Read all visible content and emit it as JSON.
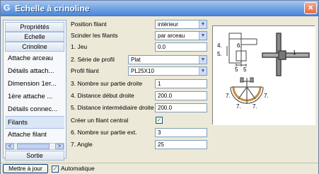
{
  "window": {
    "title": "Echelle à crinoline",
    "icon": "app-icon",
    "close_label": "×"
  },
  "sidebar": {
    "headers": [
      "Propriétés",
      "Echelle",
      "Crinoline"
    ],
    "items": [
      {
        "label": "Attache arceau",
        "selected": false
      },
      {
        "label": "Détails attach...",
        "selected": false
      },
      {
        "label": "Dimension 1er...",
        "selected": false
      },
      {
        "label": "1ère attache ...",
        "selected": false
      },
      {
        "label": "Détails connec...",
        "selected": false
      },
      {
        "label": "Filants",
        "selected": true
      },
      {
        "label": "Attache filant",
        "selected": false
      }
    ],
    "sortie_label": "Sortie",
    "scroll_left": "<",
    "scroll_right": ">"
  },
  "form": {
    "position_filant": {
      "label": "Position filant",
      "value": "intérieur"
    },
    "scinder_filants": {
      "label": "Scinder les filants",
      "value": "par arceau"
    },
    "jeu": {
      "label": "1. Jeu",
      "value": "0.0"
    },
    "serie_profil": {
      "label": "2. Série de profil",
      "value": "Plat"
    },
    "profil_filant": {
      "label": "Profil filant",
      "value": "PL25X10"
    },
    "nombre_partie_droite": {
      "label": "3. Nombre sur partie droite",
      "value": "1"
    },
    "distance_debut_droite": {
      "label": "4. Distance début droite",
      "value": "200.0"
    },
    "distance_intermediaire_droite": {
      "label": "5. Distance intermédiaire droite",
      "value": "200.0"
    },
    "creer_filant_central": {
      "label": "Créer un filant central",
      "checked": true
    },
    "nombre_partie_ext": {
      "label": "6. Nombre sur partie ext.",
      "value": "3"
    },
    "angle": {
      "label": "7. Angle",
      "value": "25"
    }
  },
  "preview": {
    "labels": [
      "4.",
      "5.",
      "6.",
      "5",
      "5",
      "1",
      "7.",
      "7.",
      "7.",
      "7."
    ]
  },
  "bottom": {
    "update_label": "Mettre à jour",
    "auto_label": "Automatique",
    "auto_checked": true
  },
  "colors": {
    "titlebar": "#4a87d8",
    "close": "#e46c46",
    "selected_item": "#dbe6f6",
    "accent_blue": "#8faed6"
  }
}
